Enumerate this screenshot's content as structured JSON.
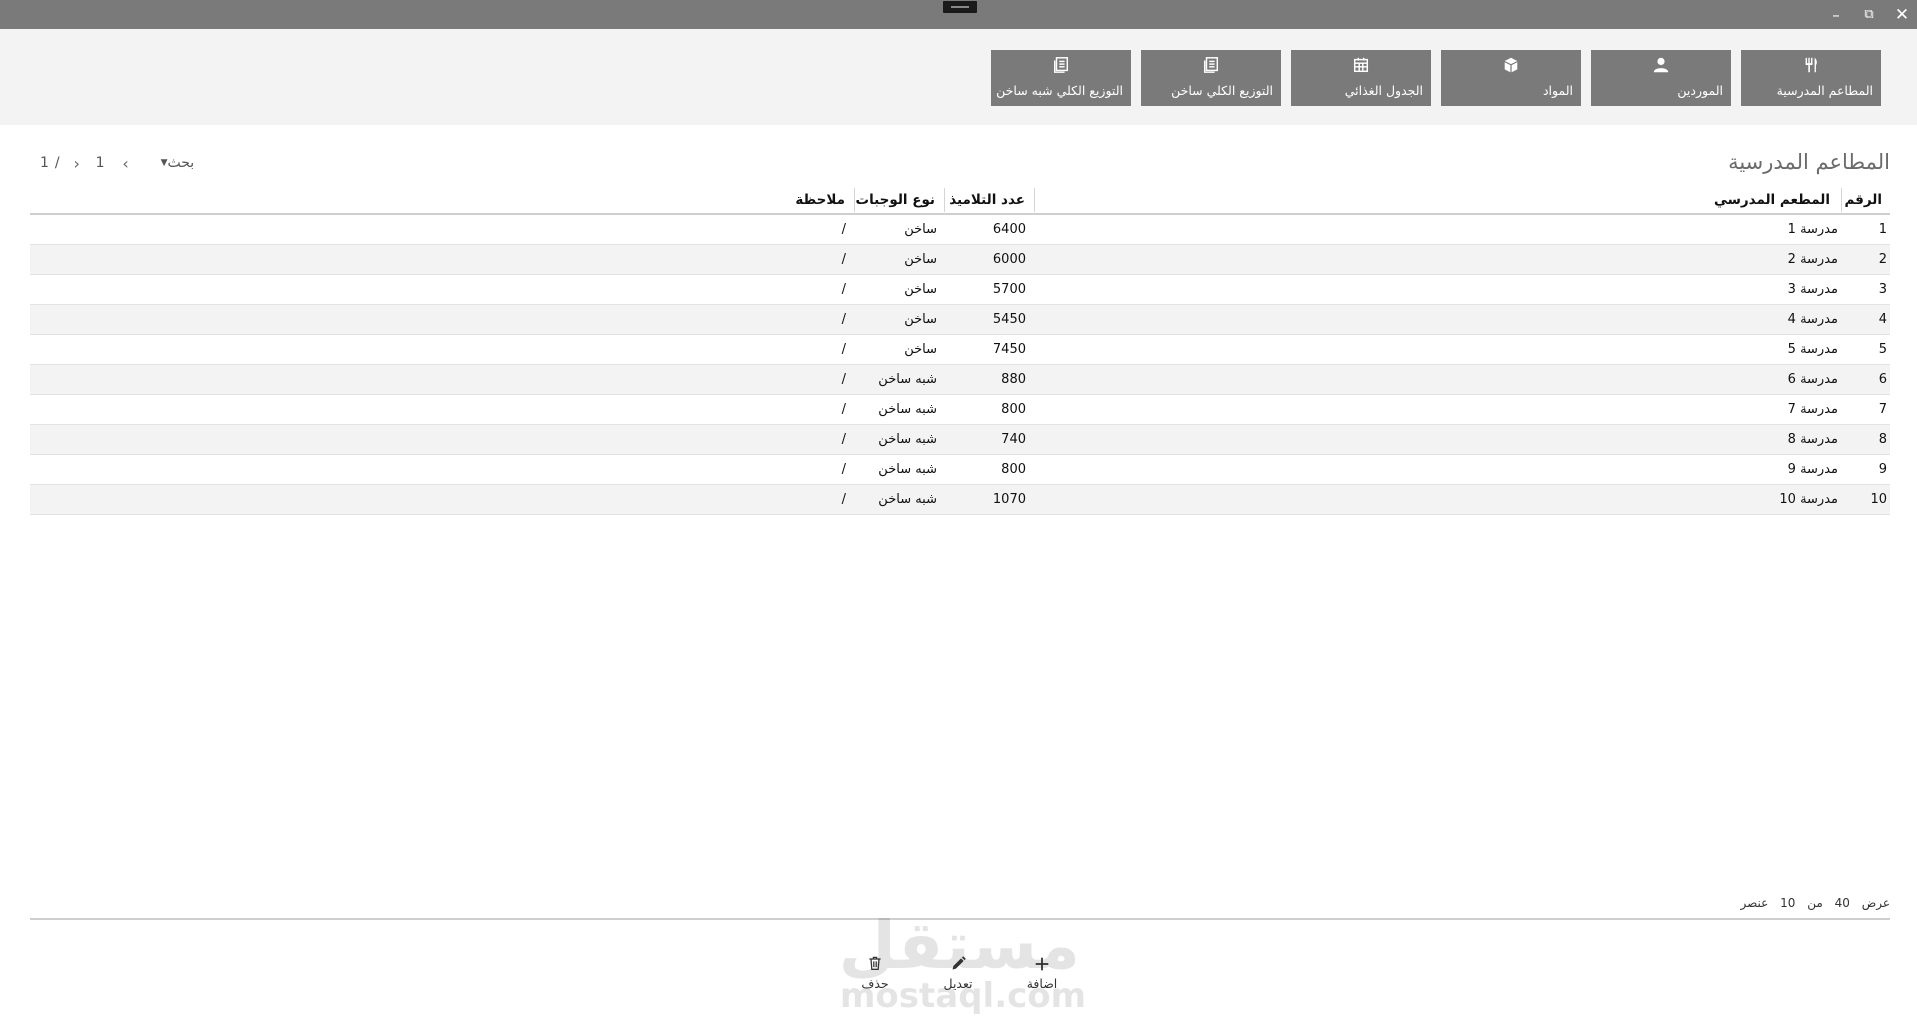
{
  "window": {
    "minimize_glyph": "–",
    "maximize_glyph": "⧉",
    "close_glyph": "✕"
  },
  "nav": [
    {
      "label": "المطاعم المدرسية",
      "icon": "utensils-icon"
    },
    {
      "label": "الموردين",
      "icon": "user-icon"
    },
    {
      "label": "المواد",
      "icon": "box-icon"
    },
    {
      "label": "الجدول الغذائي",
      "icon": "calendar-icon"
    },
    {
      "label": "التوزيع الكلي ساخن",
      "icon": "document-icon"
    },
    {
      "label": "التوزيع الكلي شبه ساخن",
      "icon": "document-icon"
    }
  ],
  "page_title": "المطاعم المدرسية",
  "pager": {
    "search_label": "بحث",
    "current_page": "1",
    "total_pages": "1",
    "separator": "/"
  },
  "table": {
    "headers": {
      "number": "الرقم",
      "restaurant": "المطعم المدرسي",
      "students": "عدد التلاميذ",
      "meal_type": "نوع الوجبات",
      "note": "ملاحظة"
    },
    "rows": [
      {
        "number": "1",
        "restaurant": "مدرسة 1",
        "students": "6400",
        "meal_type": "ساخن",
        "note": "/"
      },
      {
        "number": "2",
        "restaurant": "مدرسة 2",
        "students": "6000",
        "meal_type": "ساخن",
        "note": "/"
      },
      {
        "number": "3",
        "restaurant": "مدرسة 3",
        "students": "5700",
        "meal_type": "ساخن",
        "note": "/"
      },
      {
        "number": "4",
        "restaurant": "مدرسة 4",
        "students": "5450",
        "meal_type": "ساخن",
        "note": "/"
      },
      {
        "number": "5",
        "restaurant": "مدرسة 5",
        "students": "7450",
        "meal_type": "ساخن",
        "note": "/"
      },
      {
        "number": "6",
        "restaurant": "مدرسة 6",
        "students": "880",
        "meal_type": "شبه ساخن",
        "note": "/"
      },
      {
        "number": "7",
        "restaurant": "مدرسة 7",
        "students": "800",
        "meal_type": "شبه ساخن",
        "note": "/"
      },
      {
        "number": "8",
        "restaurant": "مدرسة 8",
        "students": "740",
        "meal_type": "شبه ساخن",
        "note": "/"
      },
      {
        "number": "9",
        "restaurant": "مدرسة 9",
        "students": "800",
        "meal_type": "شبه ساخن",
        "note": "/"
      },
      {
        "number": "10",
        "restaurant": "مدرسة 10",
        "students": "1070",
        "meal_type": "شبه ساخن",
        "note": "/"
      }
    ]
  },
  "count_info": {
    "show_label": "عرض",
    "page_size": "40",
    "of_label": "من",
    "total": "10",
    "items_label": "عنصر"
  },
  "actions": {
    "add_label": "اضافة",
    "edit_label": "تعديل",
    "delete_label": "حذف"
  },
  "watermark": {
    "arabic": "مستقل",
    "latin": "mostaql.com"
  }
}
